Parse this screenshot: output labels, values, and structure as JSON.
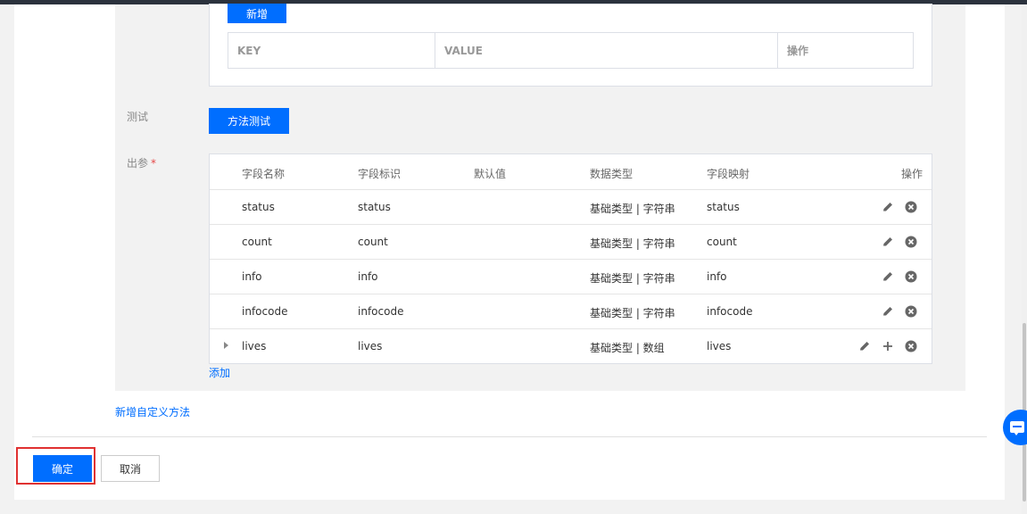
{
  "request": {
    "add_button": "新增",
    "kv_headers": [
      "KEY",
      "VALUE",
      "操作"
    ]
  },
  "test": {
    "label": "测试",
    "button": "方法测试"
  },
  "output": {
    "label": "出参",
    "required_mark": "*",
    "headers": [
      "字段名称",
      "字段标识",
      "默认值",
      "数据类型",
      "字段映射",
      "操作"
    ],
    "rows": [
      {
        "name": "status",
        "id": "status",
        "default": "",
        "type": "基础类型 | 字符串",
        "mapping": "status",
        "expandable": false,
        "actions": [
          "edit-icon",
          "delete-icon"
        ]
      },
      {
        "name": "count",
        "id": "count",
        "default": "",
        "type": "基础类型 | 字符串",
        "mapping": "count",
        "expandable": false,
        "actions": [
          "edit-icon",
          "delete-icon"
        ]
      },
      {
        "name": "info",
        "id": "info",
        "default": "",
        "type": "基础类型 | 字符串",
        "mapping": "info",
        "expandable": false,
        "actions": [
          "edit-icon",
          "delete-icon"
        ]
      },
      {
        "name": "infocode",
        "id": "infocode",
        "default": "",
        "type": "基础类型 | 字符串",
        "mapping": "infocode",
        "expandable": false,
        "actions": [
          "edit-icon",
          "delete-icon"
        ]
      },
      {
        "name": "lives",
        "id": "lives",
        "default": "",
        "type": "基础类型 | 数组",
        "mapping": "lives",
        "expandable": true,
        "actions": [
          "edit-icon",
          "plus-icon",
          "delete-icon"
        ]
      }
    ],
    "add_link": "添加"
  },
  "add_method_link": "新增自定义方法",
  "footer": {
    "confirm": "确定",
    "cancel": "取消"
  },
  "colors": {
    "primary": "#006eff",
    "highlight": "#e03131"
  },
  "floating_button_icon": "chat-icon"
}
